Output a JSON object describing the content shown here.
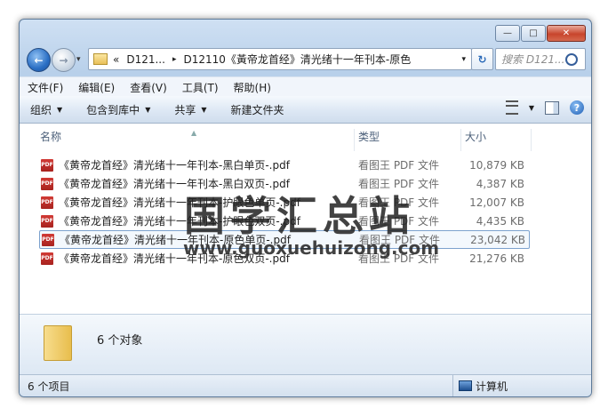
{
  "address": {
    "overflow": "«",
    "seg1": "D121...",
    "sep": "▸",
    "seg2": "D12110《黃帝龙首经》清光绪十一年刊本-原色",
    "dropdown": "▾"
  },
  "search": {
    "placeholder": "搜索 D121..."
  },
  "caption": {
    "minimize": "—",
    "maximize": "□",
    "close": "✕"
  },
  "nav": {
    "back": "←",
    "forward": "→",
    "dropdown": "▾",
    "refresh": "↻"
  },
  "menu": [
    "文件(F)",
    "编辑(E)",
    "查看(V)",
    "工具(T)",
    "帮助(H)"
  ],
  "toolbar": {
    "organize": "组织",
    "include": "包含到库中",
    "share": "共享",
    "new_folder": "新建文件夹",
    "arrow": "▼",
    "help": "?"
  },
  "columns": {
    "name": "名称",
    "type": "类型",
    "size": "大小",
    "sort": "▲"
  },
  "files": [
    {
      "name": "《黄帝龙首经》清光绪十一年刊本-黑白单页-.pdf",
      "type": "看图王 PDF 文件",
      "size": "10,879 KB"
    },
    {
      "name": "《黄帝龙首经》清光绪十一年刊本-黑白双页-.pdf",
      "type": "看图王 PDF 文件",
      "size": "4,387 KB"
    },
    {
      "name": "《黄帝龙首经》清光绪十一年刊本-护眼色单页-.pdf",
      "type": "看图王 PDF 文件",
      "size": "12,007 KB"
    },
    {
      "name": "《黄帝龙首经》清光绪十一年刊本-护眼色双页-.pdf",
      "type": "看图王 PDF 文件",
      "size": "4,435 KB"
    },
    {
      "name": "《黄帝龙首经》清光绪十一年刊本-原色单页-.pdf",
      "type": "看图王 PDF 文件",
      "size": "23,042 KB"
    },
    {
      "name": "《黄帝龙首经》清光绪十一年刊本-原色双页-.pdf",
      "type": "看图王 PDF 文件",
      "size": "21,276 KB"
    }
  ],
  "file_icon_text": "PDF",
  "watermark": {
    "cn": "国学汇总站",
    "url": "www.guoxuehuizong.com"
  },
  "details": {
    "count": "6 个对象"
  },
  "status": {
    "items": "6 个项目",
    "computer": "计算机"
  }
}
